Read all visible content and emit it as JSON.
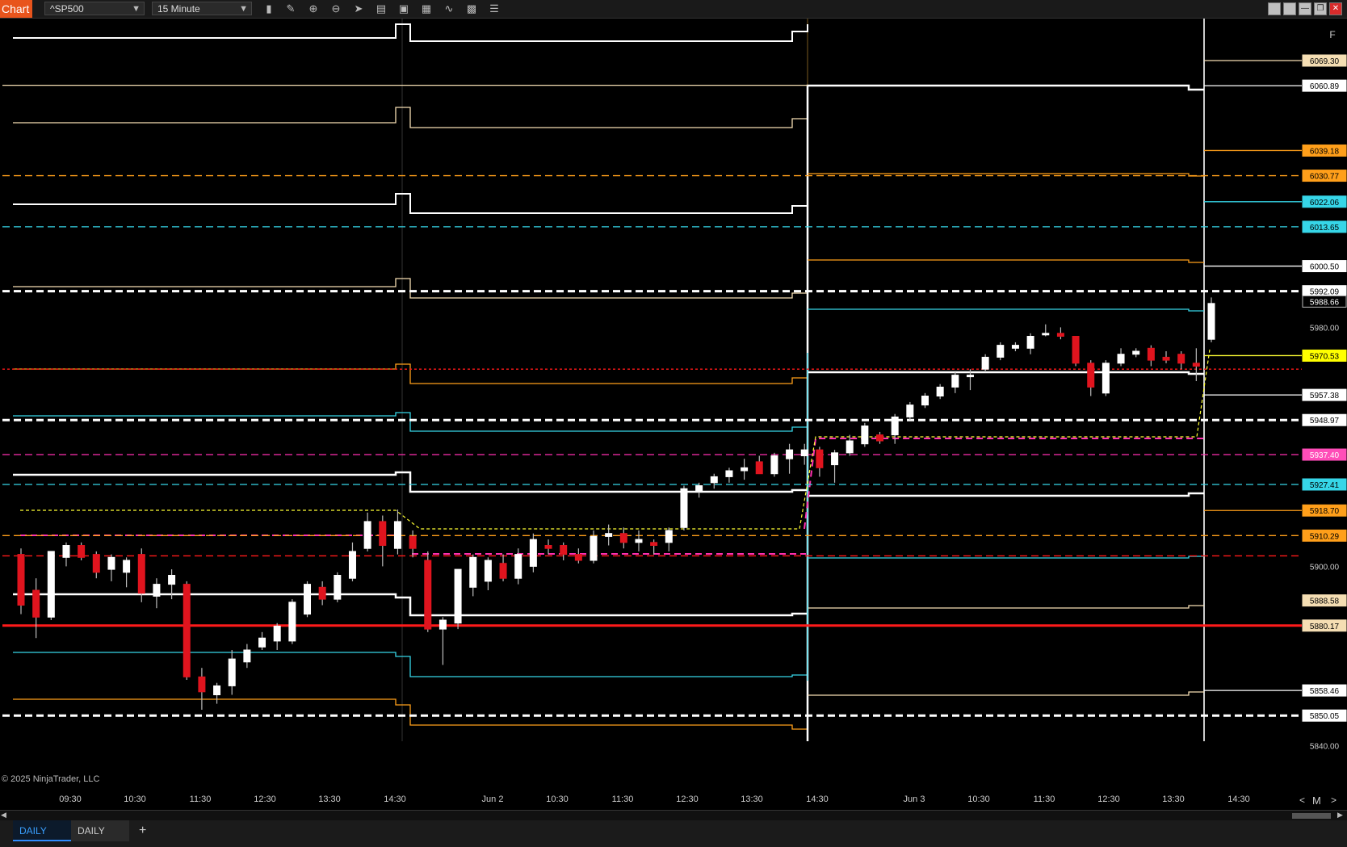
{
  "toolbar": {
    "badge": "Chart",
    "instrument": "^SP500",
    "interval": "15 Minute",
    "icons": [
      "bar-type-icon",
      "pencil-icon",
      "zoom-in-icon",
      "zoom-out-icon",
      "cursor-icon",
      "data-box-icon",
      "template-icon",
      "indicator-icon",
      "strategy-icon",
      "properties-icon",
      "list-icon"
    ]
  },
  "watermark": "© 2025 NinjaTrader, LLC",
  "time_axis": [
    "09:30",
    "10:30",
    "11:30",
    "12:30",
    "13:30",
    "14:30",
    "Jun 2",
    "10:30",
    "11:30",
    "12:30",
    "13:30",
    "14:30",
    "Jun 3",
    "10:30",
    "11:30",
    "12:30",
    "13:30",
    "14:30"
  ],
  "axis_nav": {
    "left": "<",
    "mid": "M",
    "right": ">"
  },
  "panel_f": "F",
  "tabs": {
    "active": "DAILY",
    "other": "DAILY",
    "add": "+"
  },
  "price_scale": {
    "ticks": [
      "5980.00",
      "5900.00",
      "5840.00"
    ],
    "labels": [
      {
        "text": "6069.30",
        "color": "#f5deb3",
        "fg": "#000",
        "price": 6069.3
      },
      {
        "text": "6060.89",
        "color": "#ffffff",
        "fg": "#000",
        "price": 6060.89
      },
      {
        "text": "6039.18",
        "color": "#ff9f1a",
        "fg": "#000",
        "price": 6039.18
      },
      {
        "text": "6030.77",
        "color": "#ff9f1a",
        "fg": "#000",
        "price": 6030.77
      },
      {
        "text": "6022.06",
        "color": "#36d6e8",
        "fg": "#000",
        "price": 6022.06
      },
      {
        "text": "6013.65",
        "color": "#36d6e8",
        "fg": "#000",
        "price": 6013.65
      },
      {
        "text": "6000.50",
        "color": "#ffffff",
        "fg": "#000",
        "price": 6000.5
      },
      {
        "text": "5992.09",
        "color": "#ffffff",
        "fg": "#000",
        "price": 5992.09
      },
      {
        "text": "5988.66",
        "color": "#000000",
        "fg": "#fff",
        "price": 5988.66
      },
      {
        "text": "5970.53",
        "color": "#ffff00",
        "fg": "#000",
        "price": 5970.53
      },
      {
        "text": "5957.38",
        "color": "#ffffff",
        "fg": "#000",
        "price": 5957.38
      },
      {
        "text": "5948.97",
        "color": "#ffffff",
        "fg": "#000",
        "price": 5948.97
      },
      {
        "text": "5937.40",
        "color": "#ff4db8",
        "fg": "#fff",
        "price": 5937.4
      },
      {
        "text": "5927.41",
        "color": "#36d6e8",
        "fg": "#000",
        "price": 5927.41
      },
      {
        "text": "5918.70",
        "color": "#ff9f1a",
        "fg": "#000",
        "price": 5918.7
      },
      {
        "text": "5910.29",
        "color": "#ff9f1a",
        "fg": "#000",
        "price": 5910.29
      },
      {
        "text": "5888.58",
        "color": "#f5deb3",
        "fg": "#000",
        "price": 5888.58
      },
      {
        "text": "5880.17",
        "color": "#f5deb3",
        "fg": "#000",
        "price": 5880.17
      },
      {
        "text": "5858.46",
        "color": "#ffffff",
        "fg": "#000",
        "price": 5858.46
      },
      {
        "text": "5850.05",
        "color": "#ffffff",
        "fg": "#000",
        "price": 5850.05
      }
    ]
  },
  "colors": {
    "up": "#ffffff",
    "down": "#e0141e",
    "white": "#ffffff",
    "tan": "#f5deb3",
    "orange": "#ff9f1a",
    "cyan": "#36d6e8",
    "magenta": "#ff2fb0",
    "red": "#ff1a1a",
    "yellow": "#ffff33"
  },
  "chart_data": {
    "type": "candlestick",
    "instrument": "^SP500",
    "interval": "15 Minute",
    "candles": [
      {
        "o": 5904,
        "h": 5906,
        "l": 5884,
        "c": 5887
      },
      {
        "o": 5892,
        "h": 5896,
        "l": 5876,
        "c": 5883
      },
      {
        "o": 5883,
        "h": 5905,
        "l": 5882,
        "c": 5905
      },
      {
        "o": 5903,
        "h": 5908,
        "l": 5900,
        "c": 5907
      },
      {
        "o": 5907,
        "h": 5908,
        "l": 5902,
        "c": 5903
      },
      {
        "o": 5904,
        "h": 5905,
        "l": 5896,
        "c": 5898
      },
      {
        "o": 5899,
        "h": 5904,
        "l": 5895,
        "c": 5903
      },
      {
        "o": 5898,
        "h": 5903,
        "l": 5893,
        "c": 5902
      },
      {
        "o": 5904,
        "h": 5906,
        "l": 5888,
        "c": 5891
      },
      {
        "o": 5890,
        "h": 5896,
        "l": 5886,
        "c": 5894
      },
      {
        "o": 5894,
        "h": 5899,
        "l": 5889,
        "c": 5897
      },
      {
        "o": 5894,
        "h": 5895,
        "l": 5862,
        "c": 5863
      },
      {
        "o": 5863,
        "h": 5866,
        "l": 5852,
        "c": 5858
      },
      {
        "o": 5857,
        "h": 5861,
        "l": 5854,
        "c": 5860
      },
      {
        "o": 5860,
        "h": 5872,
        "l": 5857,
        "c": 5869
      },
      {
        "o": 5868,
        "h": 5874,
        "l": 5866,
        "c": 5872
      },
      {
        "o": 5873,
        "h": 5878,
        "l": 5872,
        "c": 5876
      },
      {
        "o": 5875,
        "h": 5881,
        "l": 5872,
        "c": 5880
      },
      {
        "o": 5875,
        "h": 5889,
        "l": 5874,
        "c": 5888
      },
      {
        "o": 5884,
        "h": 5895,
        "l": 5883,
        "c": 5894
      },
      {
        "o": 5893,
        "h": 5895,
        "l": 5887,
        "c": 5889
      },
      {
        "o": 5889,
        "h": 5898,
        "l": 5888,
        "c": 5897
      },
      {
        "o": 5896,
        "h": 5908,
        "l": 5895,
        "c": 5905
      },
      {
        "o": 5906,
        "h": 5918,
        "l": 5905,
        "c": 5915
      },
      {
        "o": 5915,
        "h": 5917,
        "l": 5900,
        "c": 5907
      },
      {
        "o": 5906,
        "h": 5919,
        "l": 5904,
        "c": 5915
      },
      {
        "o": 5910,
        "h": 5912,
        "l": 5903,
        "c": 5906
      },
      {
        "o": 5902,
        "h": 5905,
        "l": 5878,
        "c": 5879
      },
      {
        "o": 5879,
        "h": 5883,
        "l": 5867,
        "c": 5882
      },
      {
        "o": 5881,
        "h": 5899,
        "l": 5879,
        "c": 5899
      },
      {
        "o": 5893,
        "h": 5904,
        "l": 5890,
        "c": 5903
      },
      {
        "o": 5895,
        "h": 5903,
        "l": 5892,
        "c": 5902
      },
      {
        "o": 5901,
        "h": 5904,
        "l": 5895,
        "c": 5896
      },
      {
        "o": 5896,
        "h": 5906,
        "l": 5894,
        "c": 5904
      },
      {
        "o": 5900,
        "h": 5911,
        "l": 5898,
        "c": 5909
      },
      {
        "o": 5907,
        "h": 5909,
        "l": 5904,
        "c": 5906
      },
      {
        "o": 5907,
        "h": 5908,
        "l": 5902,
        "c": 5904
      },
      {
        "o": 5904,
        "h": 5906,
        "l": 5901,
        "c": 5902
      },
      {
        "o": 5902,
        "h": 5912,
        "l": 5901,
        "c": 5910
      },
      {
        "o": 5910,
        "h": 5914,
        "l": 5907,
        "c": 5911
      },
      {
        "o": 5911,
        "h": 5913,
        "l": 5906,
        "c": 5908
      },
      {
        "o": 5908,
        "h": 5912,
        "l": 5905,
        "c": 5909
      },
      {
        "o": 5908,
        "h": 5909,
        "l": 5904,
        "c": 5907
      },
      {
        "o": 5908,
        "h": 5913,
        "l": 5905,
        "c": 5912
      },
      {
        "o": 5913,
        "h": 5927,
        "l": 5912,
        "c": 5926
      },
      {
        "o": 5925,
        "h": 5928,
        "l": 5923,
        "c": 5927
      },
      {
        "o": 5928,
        "h": 5931,
        "l": 5926,
        "c": 5930
      },
      {
        "o": 5930,
        "h": 5933,
        "l": 5928,
        "c": 5932
      },
      {
        "o": 5932,
        "h": 5936,
        "l": 5929,
        "c": 5933
      },
      {
        "o": 5935,
        "h": 5937,
        "l": 5932,
        "c": 5931
      },
      {
        "o": 5931,
        "h": 5938,
        "l": 5930,
        "c": 5937
      },
      {
        "o": 5936,
        "h": 5941,
        "l": 5931,
        "c": 5939
      },
      {
        "o": 5937,
        "h": 5941,
        "l": 5934,
        "c": 5939
      },
      {
        "o": 5939,
        "h": 5940,
        "l": 5930,
        "c": 5933
      },
      {
        "o": 5934,
        "h": 5939,
        "l": 5928,
        "c": 5938
      },
      {
        "o": 5938,
        "h": 5944,
        "l": 5937,
        "c": 5942
      },
      {
        "o": 5941,
        "h": 5948,
        "l": 5940,
        "c": 5947
      },
      {
        "o": 5944,
        "h": 5945,
        "l": 5941,
        "c": 5942
      },
      {
        "o": 5944,
        "h": 5951,
        "l": 5941,
        "c": 5950
      },
      {
        "o": 5950,
        "h": 5955,
        "l": 5949,
        "c": 5954
      },
      {
        "o": 5954,
        "h": 5958,
        "l": 5953,
        "c": 5957
      },
      {
        "o": 5957,
        "h": 5961,
        "l": 5956,
        "c": 5960
      },
      {
        "o": 5960,
        "h": 5965,
        "l": 5958,
        "c": 5964
      },
      {
        "o": 5964,
        "h": 5966,
        "l": 5959,
        "c": 5964
      },
      {
        "o": 5966,
        "h": 5971,
        "l": 5965,
        "c": 5970
      },
      {
        "o": 5970,
        "h": 5975,
        "l": 5969,
        "c": 5974
      },
      {
        "o": 5973,
        "h": 5975,
        "l": 5972,
        "c": 5974
      },
      {
        "o": 5973,
        "h": 5978,
        "l": 5971,
        "c": 5977
      },
      {
        "o": 5978,
        "h": 5981,
        "l": 5977,
        "c": 5978
      },
      {
        "o": 5978,
        "h": 5980,
        "l": 5976,
        "c": 5977
      },
      {
        "o": 5977,
        "h": 5977,
        "l": 5967,
        "c": 5968
      },
      {
        "o": 5968,
        "h": 5969,
        "l": 5957,
        "c": 5960
      },
      {
        "o": 5958,
        "h": 5969,
        "l": 5957,
        "c": 5968
      },
      {
        "o": 5968,
        "h": 5973,
        "l": 5967,
        "c": 5971
      },
      {
        "o": 5971,
        "h": 5973,
        "l": 5970,
        "c": 5972
      },
      {
        "o": 5973,
        "h": 5974,
        "l": 5967,
        "c": 5969
      },
      {
        "o": 5970,
        "h": 5972,
        "l": 5968,
        "c": 5969
      },
      {
        "o": 5971,
        "h": 5972,
        "l": 5966,
        "c": 5968
      },
      {
        "o": 5968,
        "h": 5973,
        "l": 5962,
        "c": 5967
      },
      {
        "o": 5976,
        "h": 5990,
        "l": 5975,
        "c": 5988
      }
    ],
    "levels": [
      {
        "price": 6069.3,
        "color": "tan",
        "style": "solid"
      },
      {
        "price": 6060.89,
        "color": "white",
        "style": "solid"
      },
      {
        "price": 6039.18,
        "color": "orange",
        "style": "solid"
      },
      {
        "price": 6030.77,
        "color": "orange",
        "style": "dashed"
      },
      {
        "price": 6022.06,
        "color": "cyan",
        "style": "solid"
      },
      {
        "price": 6013.65,
        "color": "cyan",
        "style": "dashed"
      },
      {
        "price": 6000.5,
        "color": "white",
        "style": "solid"
      },
      {
        "price": 5992.09,
        "color": "white",
        "style": "dashed"
      },
      {
        "price": 5970.53,
        "color": "yellow",
        "style": "solid"
      },
      {
        "price": 5966.0,
        "color": "red",
        "style": "dotted"
      },
      {
        "price": 5957.38,
        "color": "white",
        "style": "solid"
      },
      {
        "price": 5948.97,
        "color": "white",
        "style": "dashed"
      },
      {
        "price": 5937.4,
        "color": "magenta",
        "style": "dashed"
      },
      {
        "price": 5927.41,
        "color": "cyan",
        "style": "dashed"
      },
      {
        "price": 5918.7,
        "color": "orange",
        "style": "solid"
      },
      {
        "price": 5910.29,
        "color": "orange",
        "style": "dashed"
      },
      {
        "price": 5903.5,
        "color": "red",
        "style": "dashed"
      },
      {
        "price": 5880.17,
        "color": "red",
        "style": "solid"
      },
      {
        "price": 5858.46,
        "color": "white",
        "style": "solid"
      },
      {
        "price": 5850.05,
        "color": "white",
        "style": "dashed"
      }
    ]
  }
}
